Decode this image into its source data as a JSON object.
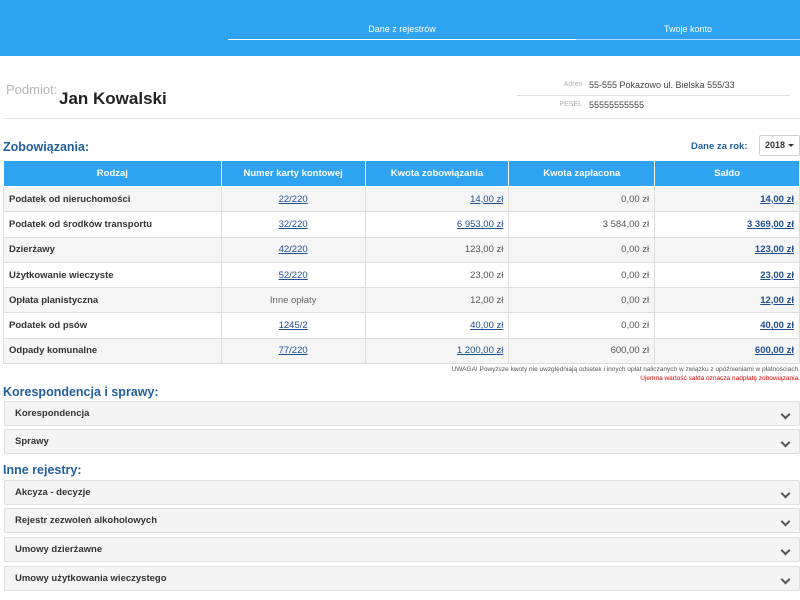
{
  "header": {
    "tabs": [
      {
        "label": "Dane z rejestrów",
        "active": true
      },
      {
        "label": "Twoje konto",
        "active": false
      }
    ]
  },
  "subject": {
    "label": "Podmiot:",
    "name": "Jan Kowalski",
    "address_label": "Adres",
    "address": "55-555 Pokazowo ul. Bielska 555/33",
    "pesel_label": "PESEL",
    "pesel": "55555555555"
  },
  "obligations": {
    "title": "Zobowiązania:",
    "year_label": "Dane za rok:",
    "year": "2018",
    "columns": [
      "Rodzaj",
      "Numer karty kontowej",
      "Kwota zobowiązania",
      "Kwota zapłacona",
      "Saldo"
    ],
    "rows": [
      {
        "rodzaj": "Podatek od nieruchomości",
        "karta": "22/220",
        "kwota": "14,00 zł",
        "zaplacona": "0,00 zł",
        "saldo": "14,00 zł"
      },
      {
        "rodzaj": "Podatek od środków transportu",
        "karta": "32/220",
        "kwota": "6 953,00 zł",
        "zaplacona": "3 584,00 zł",
        "saldo": "3 369,00 zł"
      },
      {
        "rodzaj": "Dzierżawy",
        "karta": "42/220",
        "kwota": "123,00 zł",
        "zaplacona": "0,00 zł",
        "saldo": "123,00 zł"
      },
      {
        "rodzaj": "Użytkowanie wieczyste",
        "karta": "52/220",
        "kwota": "23,00 zł",
        "zaplacona": "0,00 zł",
        "saldo": "23,00 zł"
      },
      {
        "rodzaj": "Opłata planistyczna",
        "karta": "Inne opłaty",
        "kwota": "12,00 zł",
        "zaplacona": "0,00 zł",
        "saldo": "12,00 zł"
      },
      {
        "rodzaj": "Podatek od psów",
        "karta": "1245/2",
        "kwota": "40,00 zł",
        "zaplacona": "0,00 zł",
        "saldo": "40,00 zł"
      },
      {
        "rodzaj": "Odpady komunalne",
        "karta": "77/220",
        "kwota": "1 200,00 zł",
        "zaplacona": "600,00 zł",
        "saldo": "600,00 zł"
      }
    ],
    "note": "UWAGA! Powyższe kwoty nie uwzględniają odsetek i innych opłat naliczanych w związku z opóźnieniami w płatnościach.",
    "note_red": "Ujemna wartość salda oznacza nadpłatę zobowiązania."
  },
  "correspondence": {
    "title": "Korespondencja i sprawy:",
    "items": [
      "Korespondencja",
      "Sprawy"
    ]
  },
  "registries": {
    "title": "Inne rejestry:",
    "items": [
      "Akcyza - decyzje",
      "Rejestr zezwoleń alkoholowych",
      "Umowy dzierżawne",
      "Umowy użytkowania wieczystego"
    ]
  }
}
